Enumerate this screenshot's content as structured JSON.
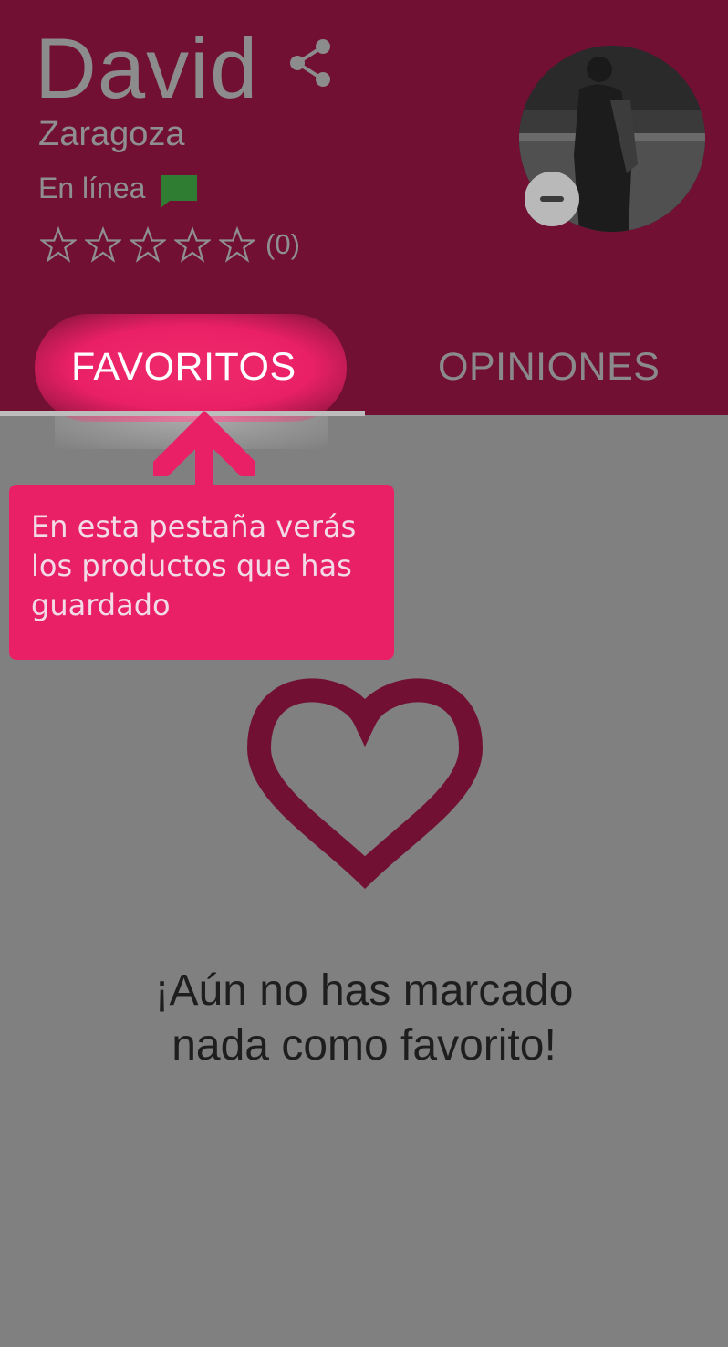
{
  "profile": {
    "name": "David",
    "city": "Zaragoza",
    "status": "En línea",
    "rating_count": "(0)",
    "rating_value": 0,
    "rating_max": 5
  },
  "tabs": [
    {
      "label": "FAVORITOS",
      "active": true
    },
    {
      "label": "OPINIONES",
      "active": false
    }
  ],
  "tooltip": {
    "text": "En esta pestaña verás los productos que has guardado"
  },
  "empty_state": {
    "line1": "¡Aún no has marcado",
    "line2": "nada como favorito!"
  },
  "icons": [
    "share-icon",
    "chat-icon",
    "star-icon",
    "minus-icon",
    "heart-icon",
    "arrow-up-icon"
  ],
  "colors": {
    "header": "#721034",
    "accent": "#e92066",
    "online": "#2e7d32",
    "overlay": "#808080"
  }
}
